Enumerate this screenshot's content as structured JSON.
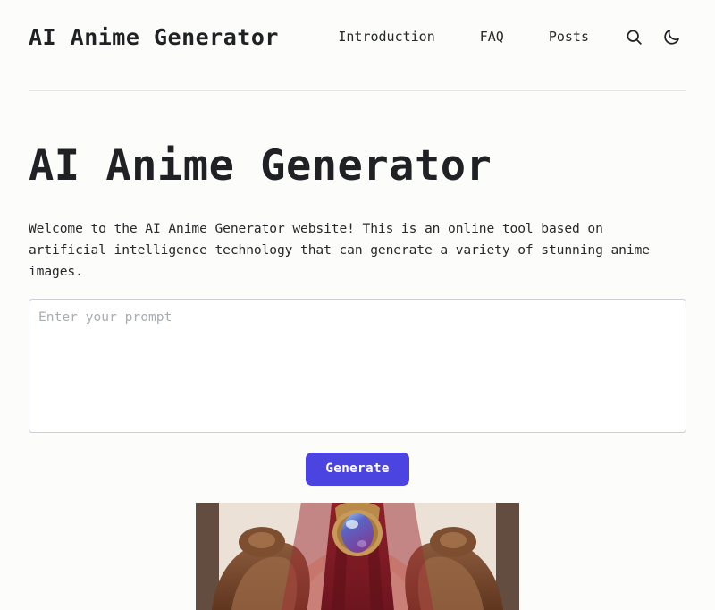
{
  "theme": {
    "background": "#fcfcfa",
    "text": "#26282b",
    "heading": "#202124",
    "accent": "#4c44e0",
    "border": "#cdd0d4",
    "rule": "#e6e6e3",
    "placeholder": "#a9adb4"
  },
  "header": {
    "logo": "AI Anime Generator",
    "nav": [
      {
        "label": "Introduction",
        "name": "nav-link-introduction"
      },
      {
        "label": "FAQ",
        "name": "nav-link-faq"
      },
      {
        "label": "Posts",
        "name": "nav-link-posts"
      }
    ],
    "icons": [
      {
        "name": "search-icon",
        "label": "Search"
      },
      {
        "name": "moon-icon",
        "label": "Toggle dark mode"
      }
    ]
  },
  "main": {
    "title": "AI Anime Generator",
    "intro": "Welcome to the AI Anime Generator website! This is an online tool based on artificial intelligence technology that can generate a variety of stunning anime images.",
    "prompt": {
      "value": "",
      "placeholder": "Enter your prompt"
    },
    "generate_label": "Generate",
    "result_image_alt": "Generated anime character illustration"
  }
}
